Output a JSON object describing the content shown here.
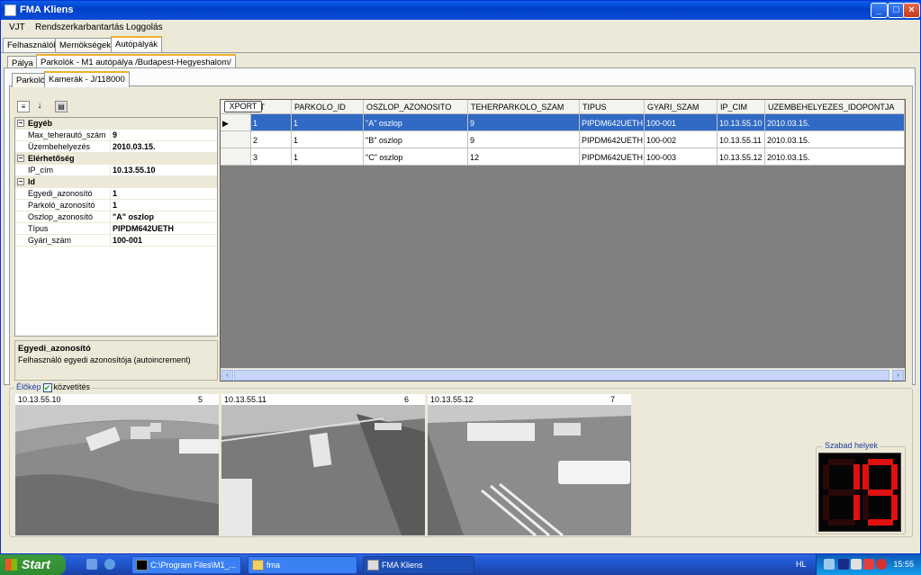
{
  "window": {
    "title": "FMA Kliens",
    "controls": [
      "_",
      "□",
      "×"
    ]
  },
  "menu": [
    "VJT",
    "Rendszerkarbantartás",
    "Loggolás"
  ],
  "tabs_top": [
    "Felhasználók",
    "Mernökségek",
    "Autópályák"
  ],
  "tabs_second": [
    "Pálya",
    "Parkolók - M1 autópálya /Budapest-Hegyeshalom/"
  ],
  "tabs_third": [
    "Parkoló",
    "Kamerák - J/118000"
  ],
  "property_grid": {
    "categories": [
      {
        "name": "Egyéb",
        "items": [
          {
            "key": "Max_teherautó_szám",
            "value": "9"
          },
          {
            "key": "Üzembehelyezés",
            "value": "2010.03.15."
          }
        ]
      },
      {
        "name": "Elérhetőség",
        "items": [
          {
            "key": "IP_cím",
            "value": "10.13.55.10"
          }
        ]
      },
      {
        "name": "Id",
        "items": [
          {
            "key": "Egyedi_azonosító",
            "value": "1"
          },
          {
            "key": "Parkoló_azonosító",
            "value": "1"
          },
          {
            "key": "Oszlop_azonosító",
            "value": "\"A\" oszlop"
          },
          {
            "key": "Típus",
            "value": "PIPDM642UETH"
          },
          {
            "key": "Gyári_szám",
            "value": "100-001"
          }
        ]
      }
    ],
    "description_title": "Egyedi_azonosító",
    "description_text": "Felhasználó egyedi azonosítója (autoincrement)"
  },
  "table": {
    "export_label": "XPORT",
    "headers": [
      "NT",
      "PARKOLO_ID",
      "OSZLOP_AZONOSITO",
      "TEHERPARKOLO_SZAM",
      "TIPUS",
      "GYARI_SZAM",
      "IP_CIM",
      "UZEMBEHELYEZES_IDOPONTJA"
    ],
    "rows": [
      [
        "1",
        "1",
        "\"A\" oszlop",
        "9",
        "PIPDM642UETH",
        "100-001",
        "10.13.55.10",
        "2010.03.15."
      ],
      [
        "2",
        "1",
        "\"B\" oszlop",
        "9",
        "PIPDM642UETH",
        "100-002",
        "10.13.55.11",
        "2010.03.15."
      ],
      [
        "3",
        "1",
        "\"C\" oszlop",
        "12",
        "PIPDM642UETH",
        "100-003",
        "10.13.55.12",
        "2010.03.15."
      ]
    ],
    "selected_row": 0,
    "row_marker": "▶"
  },
  "live": {
    "label": "Élőkép",
    "checkbox_label": "közvetítés",
    "checked": true
  },
  "cameras": [
    {
      "ip": "10.13.55.10",
      "number": "5"
    },
    {
      "ip": "10.13.55.11",
      "number": "6"
    },
    {
      "ip": "10.13.55.12",
      "number": "7"
    }
  ],
  "free_spaces": {
    "label": "Szabad helyek",
    "value": "19",
    "color": "#e01010"
  },
  "taskbar": {
    "start_label": "Start",
    "buttons": [
      "C:\\Program Files\\M1_...",
      "fma",
      "FMA Kliens"
    ],
    "active_index": 2,
    "lang": "HL",
    "clock": "15:55"
  }
}
